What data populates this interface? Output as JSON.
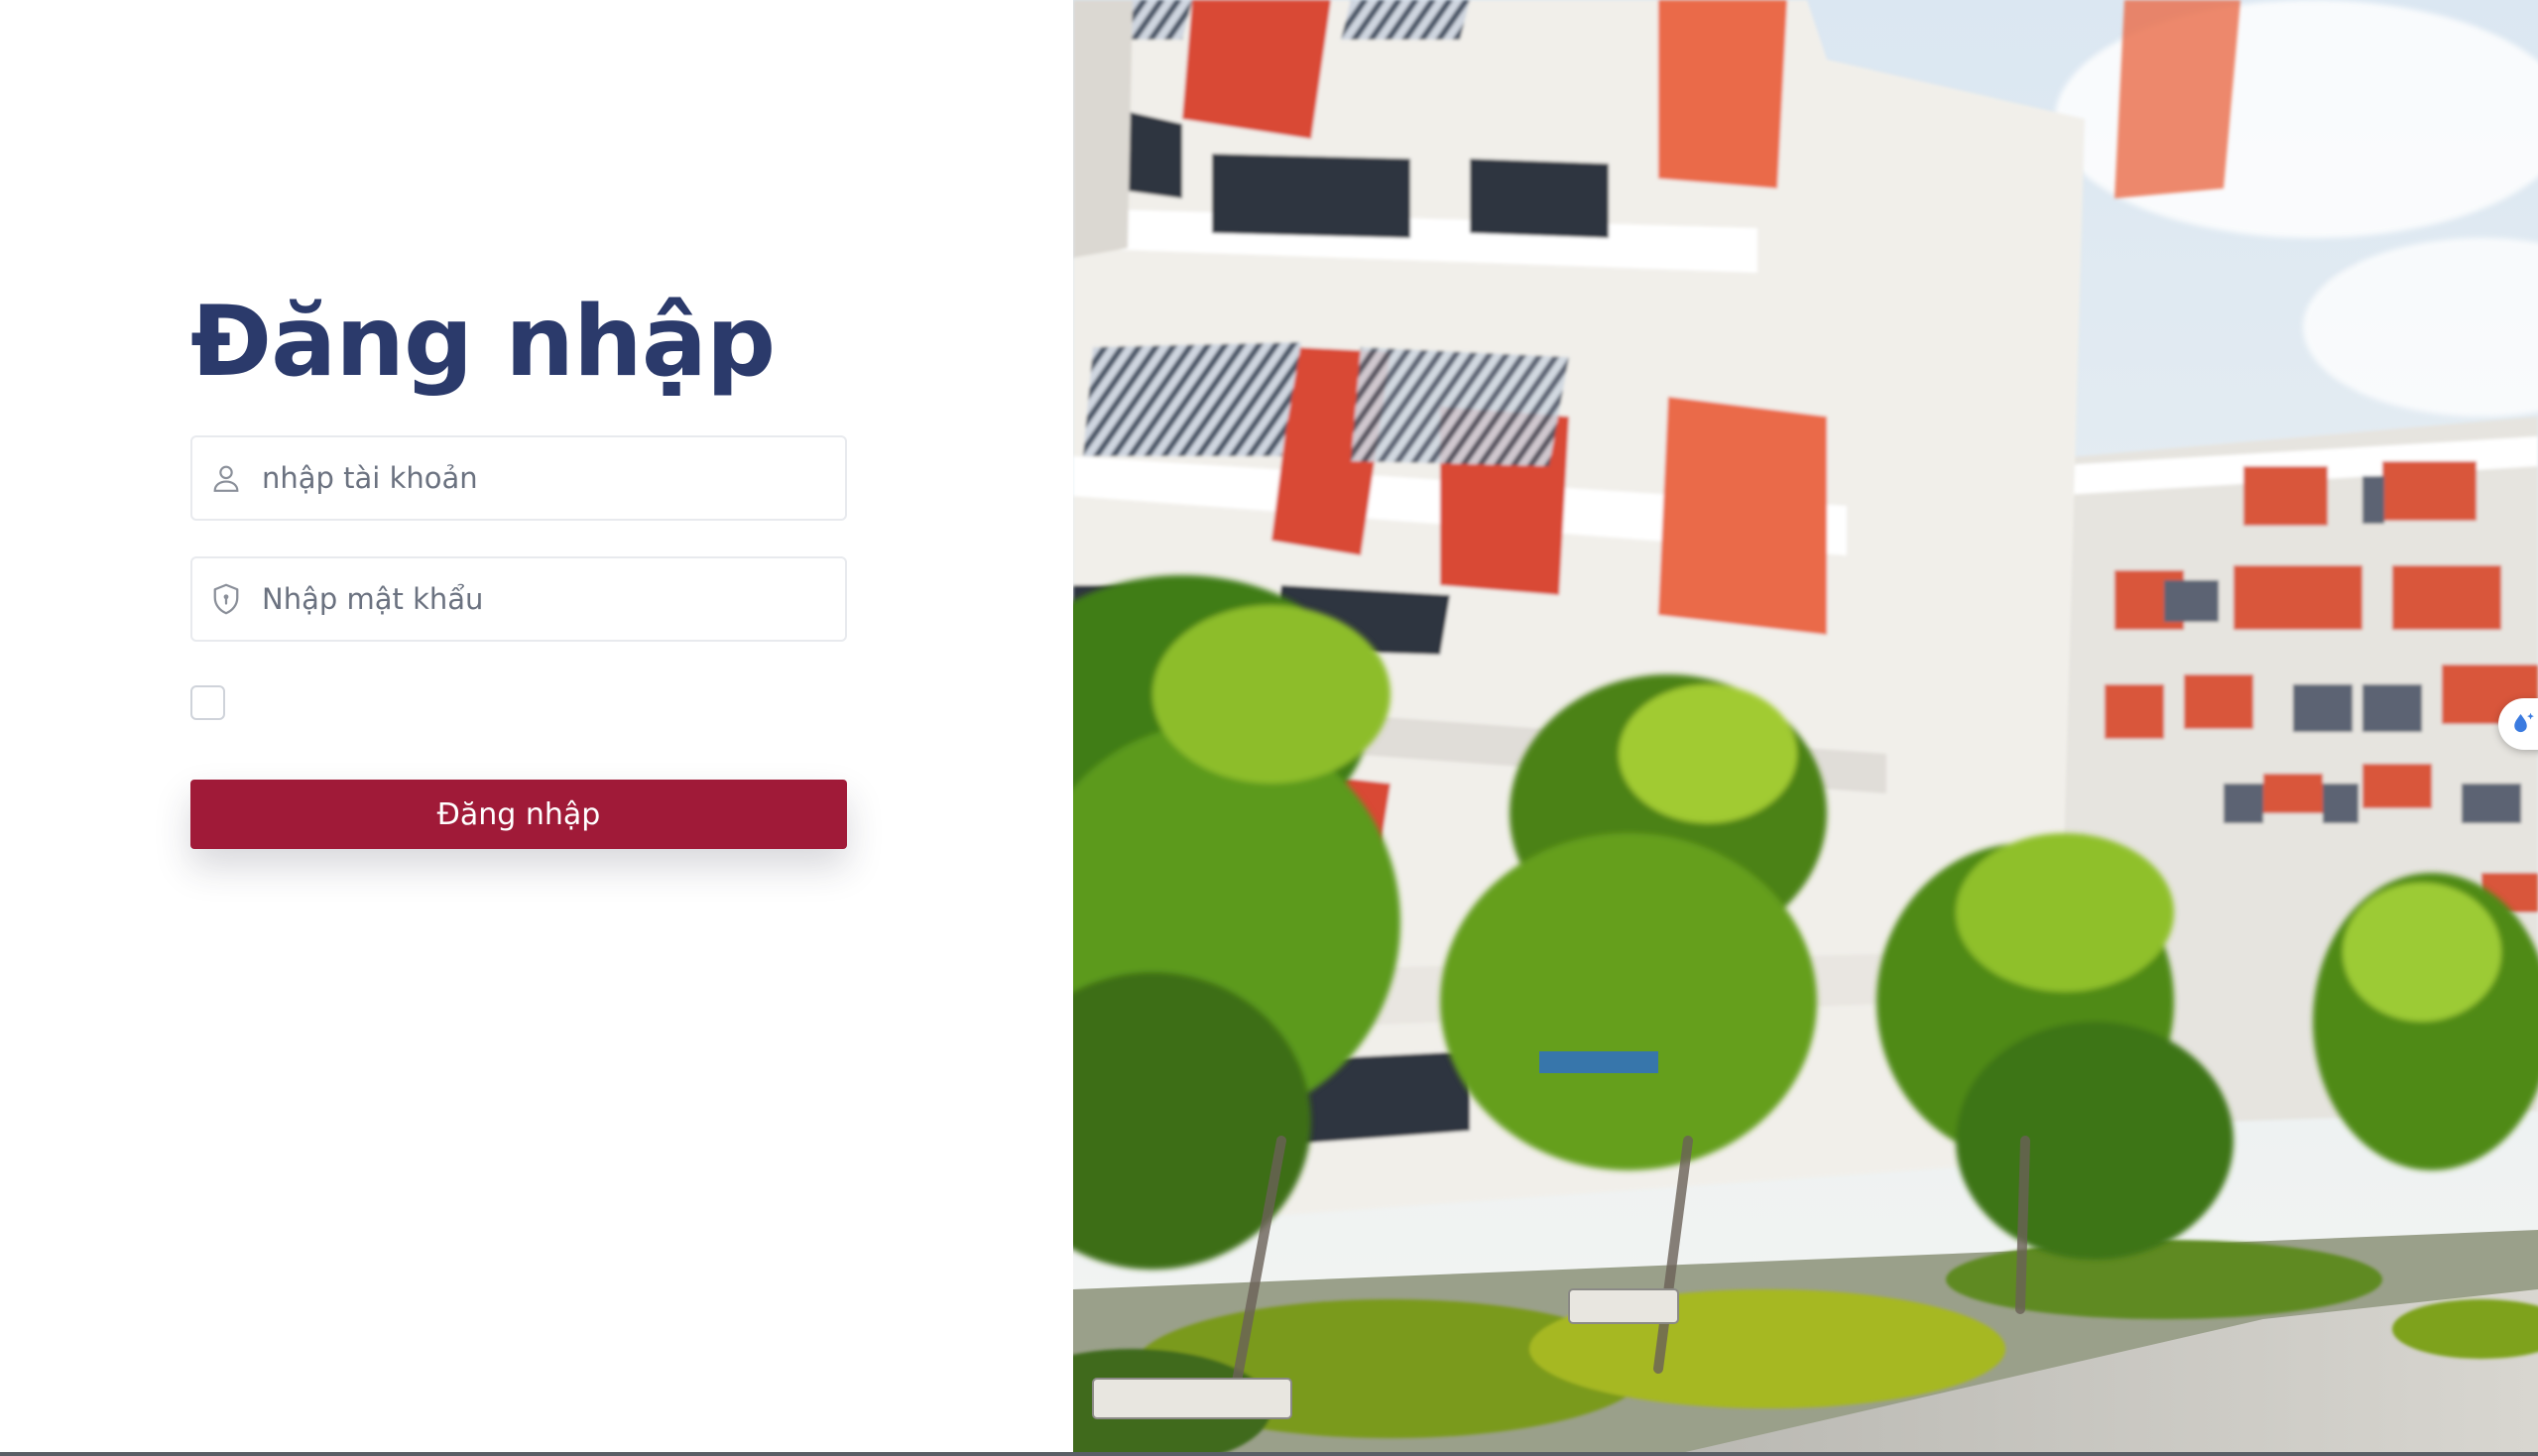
{
  "login": {
    "title": "Đăng nhập",
    "username_placeholder": "nhập tài khoản",
    "username_value": "",
    "password_placeholder": "Nhập mật khẩu",
    "password_value": "",
    "remember_checked": false,
    "submit_label": "Đăng nhập"
  },
  "icons": {
    "username": "user-icon",
    "password": "shield-lock-icon",
    "floating_tool": "water-drop-sparkle-icon"
  },
  "colors": {
    "title": "#2b3a6b",
    "button": "#a01a38",
    "button_text": "#ffffff",
    "field_border": "#e8eaee",
    "placeholder": "#6b7280"
  },
  "hero_image": {
    "subject": "campus-building-photo"
  }
}
